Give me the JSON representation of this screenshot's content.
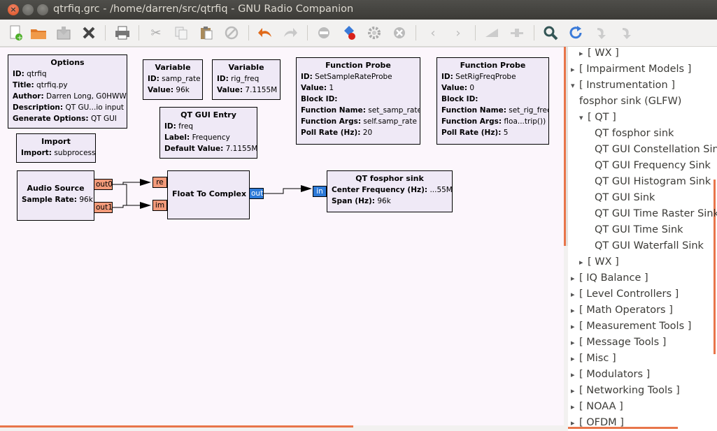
{
  "window": {
    "title": "qtrfiq.grc - /home/darren/src/qtrfiq - GNU Radio Companion"
  },
  "toolbar": {
    "icons": [
      "new-icon",
      "open-icon",
      "save-icon",
      "close-file-icon",
      "print-icon",
      "cut-icon",
      "copy-icon",
      "paste-icon",
      "delete-icon",
      "undo-icon",
      "redo-icon",
      "disable-icon",
      "generate-icon",
      "execute-icon",
      "kill-icon",
      "rotate-ccw-icon",
      "rotate-cw-icon",
      "enable-icon",
      "bypass-icon",
      "find-icon",
      "reload-icon",
      "up-icon",
      "down-icon"
    ]
  },
  "blocks": {
    "options": {
      "title": "Options",
      "rows": [
        [
          "ID:",
          "qtrfiq"
        ],
        [
          "Title:",
          "qtrfiq.py"
        ],
        [
          "Author:",
          "Darren Long, G0HWW"
        ],
        [
          "Description:",
          "QT GU...io input"
        ],
        [
          "Generate Options:",
          "QT GUI"
        ]
      ]
    },
    "var1": {
      "title": "Variable",
      "rows": [
        [
          "ID:",
          "samp_rate"
        ],
        [
          "Value:",
          "96k"
        ]
      ]
    },
    "var2": {
      "title": "Variable",
      "rows": [
        [
          "ID:",
          "rig_freq"
        ],
        [
          "Value:",
          "7.1155M"
        ]
      ]
    },
    "entry": {
      "title": "QT GUI Entry",
      "rows": [
        [
          "ID:",
          "freq"
        ],
        [
          "Label:",
          "Frequency"
        ],
        [
          "Default Value:",
          "7.1155M"
        ]
      ]
    },
    "probe1": {
      "title": "Function Probe",
      "rows": [
        [
          "ID:",
          "SetSampleRateProbe"
        ],
        [
          "Value:",
          "1"
        ],
        [
          "Block ID:",
          ""
        ],
        [
          "Function Name:",
          "set_samp_rate"
        ],
        [
          "Function Args:",
          "self.samp_rate"
        ],
        [
          "Poll Rate (Hz):",
          "20"
        ]
      ]
    },
    "probe2": {
      "title": "Function Probe",
      "rows": [
        [
          "ID:",
          "SetRigFreqProbe"
        ],
        [
          "Value:",
          "0"
        ],
        [
          "Block ID:",
          ""
        ],
        [
          "Function Name:",
          "set_rig_freq"
        ],
        [
          "Function Args:",
          "floa...trip())"
        ],
        [
          "Poll Rate (Hz):",
          "5"
        ]
      ]
    },
    "import": {
      "title": "Import",
      "rows": [
        [
          "Import:",
          "subprocess"
        ]
      ]
    },
    "audio": {
      "title": "Audio Source",
      "rows": [
        [
          "Sample Rate:",
          "96k"
        ]
      ],
      "ports": [
        "out0",
        "out1"
      ]
    },
    "f2c": {
      "title": "Float To Complex",
      "ports_in": [
        "re",
        "im"
      ],
      "port_out": "out"
    },
    "fosphor": {
      "title": "QT fosphor sink",
      "rows": [
        [
          "Center Frequency (Hz):",
          "...55M"
        ],
        [
          "Span (Hz):",
          "96k"
        ]
      ],
      "port_in": "in"
    }
  },
  "tree": [
    {
      "label": "[ WX ]",
      "level": 1,
      "arrow": "▸"
    },
    {
      "label": "[ Impairment Models ]",
      "level": 0,
      "arrow": "▸"
    },
    {
      "label": "[ Instrumentation ]",
      "level": 0,
      "arrow": "▾"
    },
    {
      "label": "fosphor sink (GLFW)",
      "level": 1,
      "arrow": ""
    },
    {
      "label": "[ QT ]",
      "level": 1,
      "arrow": "▾"
    },
    {
      "label": "QT fosphor sink",
      "level": 2,
      "arrow": ""
    },
    {
      "label": "QT GUI Constellation Sink",
      "level": 2,
      "arrow": ""
    },
    {
      "label": "QT GUI Frequency Sink",
      "level": 2,
      "arrow": ""
    },
    {
      "label": "QT GUI Histogram Sink",
      "level": 2,
      "arrow": ""
    },
    {
      "label": "QT GUI Sink",
      "level": 2,
      "arrow": ""
    },
    {
      "label": "QT GUI Time Raster Sink",
      "level": 2,
      "arrow": ""
    },
    {
      "label": "QT GUI Time Sink",
      "level": 2,
      "arrow": ""
    },
    {
      "label": "QT GUI Waterfall Sink",
      "level": 2,
      "arrow": ""
    },
    {
      "label": "[ WX ]",
      "level": 1,
      "arrow": "▸"
    },
    {
      "label": "[ IQ Balance ]",
      "level": 0,
      "arrow": "▸"
    },
    {
      "label": "[ Level Controllers ]",
      "level": 0,
      "arrow": "▸"
    },
    {
      "label": "[ Math Operators ]",
      "level": 0,
      "arrow": "▸"
    },
    {
      "label": "[ Measurement Tools ]",
      "level": 0,
      "arrow": "▸"
    },
    {
      "label": "[ Message Tools ]",
      "level": 0,
      "arrow": "▸"
    },
    {
      "label": "[ Misc ]",
      "level": 0,
      "arrow": "▸"
    },
    {
      "label": "[ Modulators ]",
      "level": 0,
      "arrow": "▸"
    },
    {
      "label": "[ Networking Tools ]",
      "level": 0,
      "arrow": "▸"
    },
    {
      "label": "[ NOAA ]",
      "level": 0,
      "arrow": "▸"
    },
    {
      "label": "[ OFDM ]",
      "level": 0,
      "arrow": "▸"
    }
  ]
}
